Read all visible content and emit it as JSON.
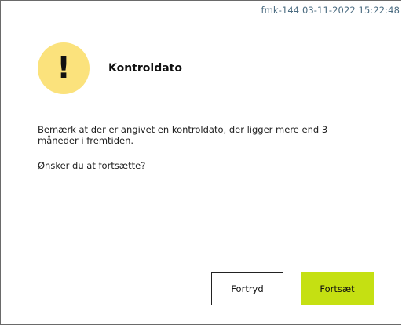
{
  "dialog": {
    "meta_info": "fmk-144 03-11-2022 15:22:48",
    "icon": "exclamation-warning-icon",
    "icon_glyph": "!",
    "icon_color": "#fbe27c",
    "title": "Kontroldato",
    "message": "Bemærk at der er angivet en kontroldato, der ligger mere end 3 måneder i fremtiden.",
    "question": "Ønsker du at fortsætte?"
  },
  "buttons": {
    "cancel_label": "Fortryd",
    "continue_label": "Fortsæt",
    "continue_color": "#c5e012"
  }
}
